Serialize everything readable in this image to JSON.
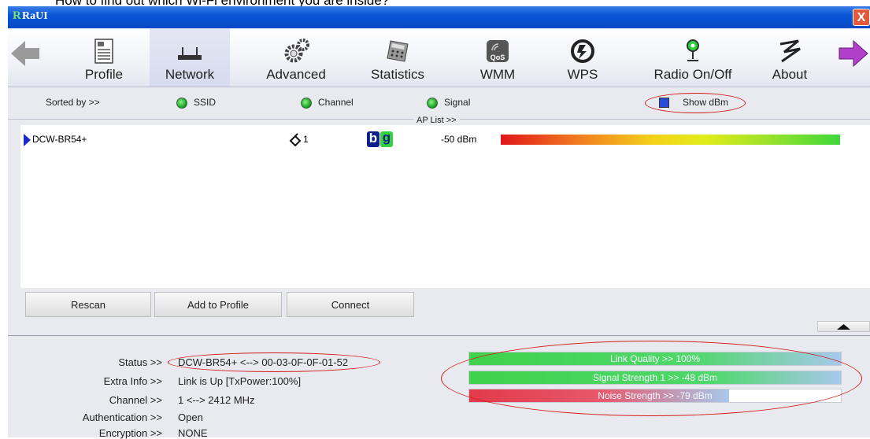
{
  "caption": "How to find out which Wi-Fi environment you are inside?",
  "window": {
    "logo": "R",
    "title": "RaUI",
    "close": "X"
  },
  "toolbar": {
    "items": [
      {
        "label": "Profile",
        "icon": "profile-icon"
      },
      {
        "label": "Network",
        "icon": "network-icon"
      },
      {
        "label": "Advanced",
        "icon": "gears-icon"
      },
      {
        "label": "Statistics",
        "icon": "calculator-icon"
      },
      {
        "label": "WMM",
        "icon": "qos-icon"
      },
      {
        "label": "WPS",
        "icon": "wps-icon"
      },
      {
        "label": "Radio On/Off",
        "icon": "antenna-icon"
      },
      {
        "label": "About",
        "icon": "about-icon"
      }
    ]
  },
  "sort": {
    "label": "Sorted by >>",
    "ssid": "SSID",
    "channel": "Channel",
    "signal": "Signal",
    "show_dbm": "Show dBm"
  },
  "aplist": {
    "label": "AP List >>",
    "rows": [
      {
        "ssid": "DCW-BR54+",
        "channel": "1",
        "mode_b": "b",
        "mode_g": "g",
        "signal": "-50 dBm"
      }
    ]
  },
  "buttons": {
    "rescan": "Rescan",
    "add_to_profile": "Add to Profile",
    "connect": "Connect"
  },
  "info": {
    "status_label": "Status >>",
    "status": "DCW-BR54+ <--> 00-03-0F-0F-01-52",
    "extra_label": "Extra Info >>",
    "extra": "Link is Up [TxPower:100%]",
    "channel_label": "Channel >>",
    "channel": "1 <--> 2412 MHz",
    "auth_label": "Authentication >>",
    "auth": "Open",
    "enc_label": "Encryption >>",
    "enc": "NONE"
  },
  "bars": {
    "link_quality": "Link Quality >> 100%",
    "signal_strength": "Signal Strength 1 >> -48 dBm",
    "noise_strength": "Noise Strength >> -79 dBm",
    "link_quality_pct": 100,
    "signal_strength_pct": 100,
    "noise_strength_pct": 70
  },
  "colors": {
    "title_bar": "#0a56d8",
    "ellipse": "#d21c1c",
    "bar_green": "#3fd24c",
    "noise_red": "#e23a4a",
    "ap_triangle": "#1d2ac8"
  }
}
